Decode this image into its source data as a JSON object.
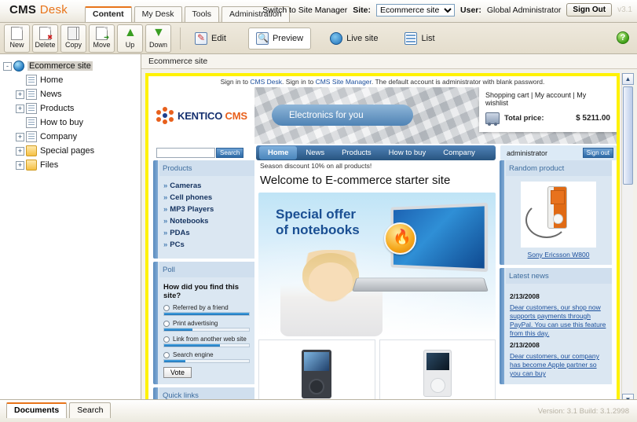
{
  "app": {
    "logo_cms": "CMS",
    "logo_desk": "Desk",
    "version_tag": "v3.1",
    "build_info": "Version: 3.1 Build: 3.1.2998"
  },
  "main_tabs": [
    {
      "label": "Content",
      "active": true
    },
    {
      "label": "My Desk",
      "active": false
    },
    {
      "label": "Tools",
      "active": false
    },
    {
      "label": "Administration",
      "active": false
    }
  ],
  "header_right": {
    "switch_link": "Switch to Site Manager",
    "site_label": "Site:",
    "site_value": "Ecommerce site",
    "site_options": [
      "Ecommerce site"
    ],
    "user_label": "User:",
    "user_value": "Global Administrator",
    "sign_out": "Sign Out"
  },
  "toolbar": {
    "actions": [
      {
        "label": "New",
        "icon": "new-document-icon"
      },
      {
        "label": "Delete",
        "icon": "delete-document-icon"
      },
      {
        "label": "Copy",
        "icon": "copy-document-icon"
      },
      {
        "label": "Move",
        "icon": "move-document-icon"
      },
      {
        "label": "Up",
        "icon": "arrow-up-icon"
      },
      {
        "label": "Down",
        "icon": "arrow-down-icon"
      }
    ],
    "modes": [
      {
        "label": "Edit",
        "icon": "edit-icon",
        "active": false
      },
      {
        "label": "Preview",
        "icon": "preview-icon",
        "active": true
      },
      {
        "label": "Live site",
        "icon": "globe-icon",
        "active": false
      },
      {
        "label": "List",
        "icon": "list-icon",
        "active": false
      }
    ],
    "help": "?"
  },
  "tree": {
    "nodes": [
      {
        "label": "Ecommerce site",
        "icon": "globe-icon",
        "depth": 0,
        "expander": "-",
        "selected": true
      },
      {
        "label": "Home",
        "icon": "page-icon",
        "depth": 1,
        "expander": "",
        "selected": false
      },
      {
        "label": "News",
        "icon": "page-icon",
        "depth": 1,
        "expander": "+",
        "selected": false
      },
      {
        "label": "Products",
        "icon": "page-icon",
        "depth": 1,
        "expander": "+",
        "selected": false
      },
      {
        "label": "How to buy",
        "icon": "page-icon",
        "depth": 1,
        "expander": "",
        "selected": false
      },
      {
        "label": "Company",
        "icon": "page-icon",
        "depth": 1,
        "expander": "+",
        "selected": false
      },
      {
        "label": "Special pages",
        "icon": "folder-icon",
        "depth": 1,
        "expander": "+",
        "selected": false
      },
      {
        "label": "Files",
        "icon": "folder-icon",
        "depth": 1,
        "expander": "+",
        "selected": false
      }
    ]
  },
  "breadcrumb": "Ecommerce site",
  "site": {
    "signin_prefix": "Sign in to ",
    "signin_link1": "CMS Desk",
    "signin_mid": ". Sign in to ",
    "signin_link2": "CMS Site Manager",
    "signin_suffix": ". The default account is administrator with blank password.",
    "logo_text": "KENTICO",
    "logo_accent": "CMS",
    "hero_slogan": "Electronics for you",
    "cart_links": "Shopping cart | My account | My wishlist",
    "cart_total_label": "Total price:",
    "cart_total_value": "$ 5211.00",
    "search_placeholder": "",
    "search_button": "Search",
    "nav": [
      {
        "label": "Home",
        "active": true
      },
      {
        "label": "News",
        "active": false
      },
      {
        "label": "Products",
        "active": false
      },
      {
        "label": "How to buy",
        "active": false
      },
      {
        "label": "Company",
        "active": false
      }
    ],
    "user_name": "administrator",
    "user_signout": "Sign out",
    "products_widget": {
      "title": "Products",
      "items": [
        "Cameras",
        "Cell phones",
        "MP3 Players",
        "Notebooks",
        "PDAs",
        "PCs"
      ]
    },
    "poll_widget": {
      "title": "Poll",
      "question": "How did you find this site?",
      "options": [
        {
          "label": "Referred by a friend",
          "percent": 100
        },
        {
          "label": "Print advertising",
          "percent": 33
        },
        {
          "label": "Link from another web site",
          "percent": 66
        },
        {
          "label": "Search engine",
          "percent": 25
        }
      ],
      "vote_button": "Vote"
    },
    "quick_links_title": "Quick links",
    "promo_line": "Season discount 10% on all products!",
    "page_heading": "Welcome to E-commerce starter site",
    "banner_line1": "Special offer",
    "banner_line2": "of notebooks",
    "random_product": {
      "title": "Random product",
      "product_name": "Sony Ericsson W800"
    },
    "latest_news": {
      "title": "Latest news",
      "items": [
        {
          "date": "2/13/2008",
          "text": "Dear customers, our shop now supports payments through PayPal. You can use this feature from this day."
        },
        {
          "date": "2/13/2008",
          "text": "Dear customers, our company has become Apple partner so you can buy"
        }
      ]
    }
  },
  "bottom_tabs": [
    {
      "label": "Documents",
      "active": true
    },
    {
      "label": "Search",
      "active": false
    }
  ],
  "colors": {
    "accent_orange": "#e8741a",
    "chrome_beige": "#e4ddcc",
    "site_blue": "#2f608f",
    "preview_frame_yellow": "#fff200",
    "link_blue": "#1b4f9c"
  }
}
